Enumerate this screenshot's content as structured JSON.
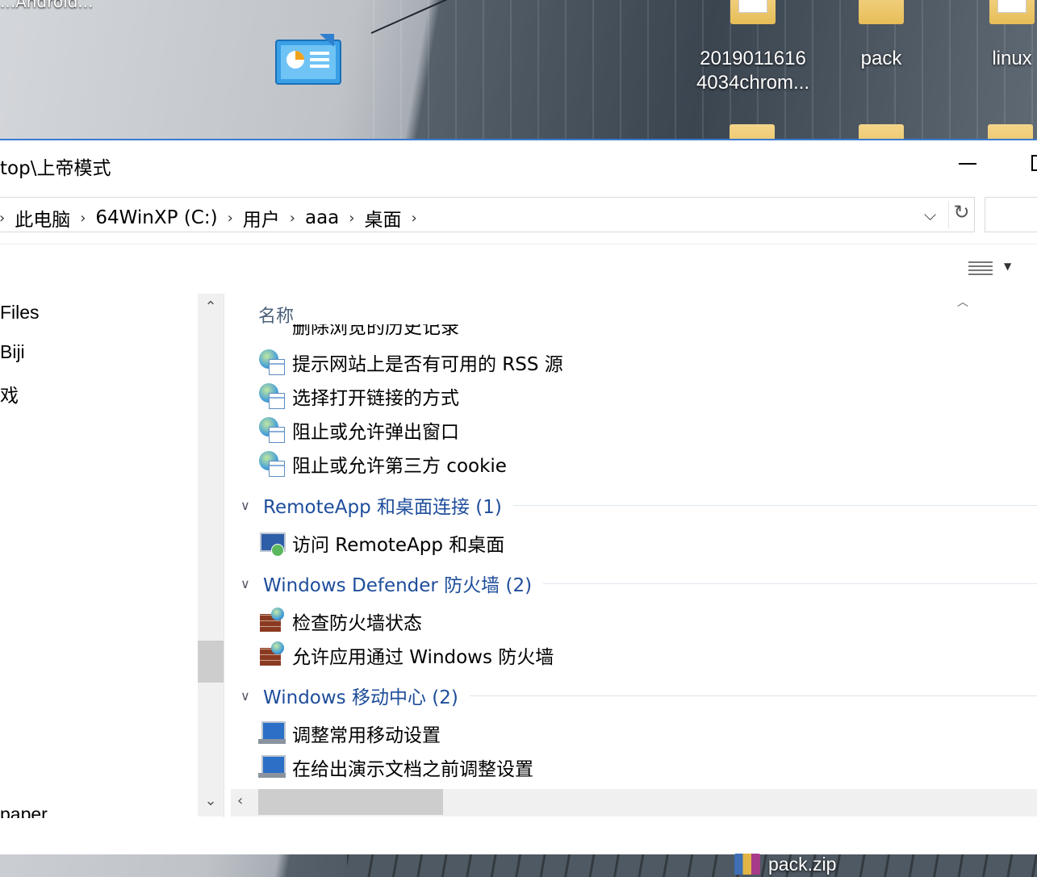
{
  "desktop": {
    "top_left_text": "...Android...",
    "icons": [
      {
        "label_line1": "2019011616",
        "label_line2": "4034chrom..."
      },
      {
        "label_line1": "pack",
        "label_line2": ""
      },
      {
        "label_line1": "linux",
        "label_line2": ""
      }
    ],
    "bottom_item": "pack.zip"
  },
  "window": {
    "title": "top\\上帝模式",
    "breadcrumbs": [
      "此电脑",
      "64WinXP (C:)",
      "用户",
      "aaa",
      "桌面"
    ]
  },
  "nav": {
    "items": [
      "Files",
      "Biji",
      "戏",
      "paper"
    ]
  },
  "filelist": {
    "column_name": "名称",
    "partial_item": "删除浏览的历史记录",
    "rows_internet": [
      "提示网站上是否有可用的 RSS 源",
      "选择打开链接的方式",
      "阻止或允许弹出窗口",
      "阻止或允许第三方 cookie"
    ],
    "groups": [
      {
        "label": "RemoteApp 和桌面连接 (1)",
        "items": [
          "访问 RemoteApp 和桌面"
        ]
      },
      {
        "label": "Windows Defender 防火墙 (2)",
        "items": [
          "检查防火墙状态",
          "允许应用通过 Windows 防火墙"
        ]
      },
      {
        "label": "Windows 移动中心 (2)",
        "items": [
          "调整常用移动设置",
          "在给出演示文档之前调整设置"
        ]
      }
    ]
  },
  "colors": {
    "group_header": "#1e4d9b",
    "column_header": "#4c607a",
    "window_border": "#3a7ad0"
  }
}
